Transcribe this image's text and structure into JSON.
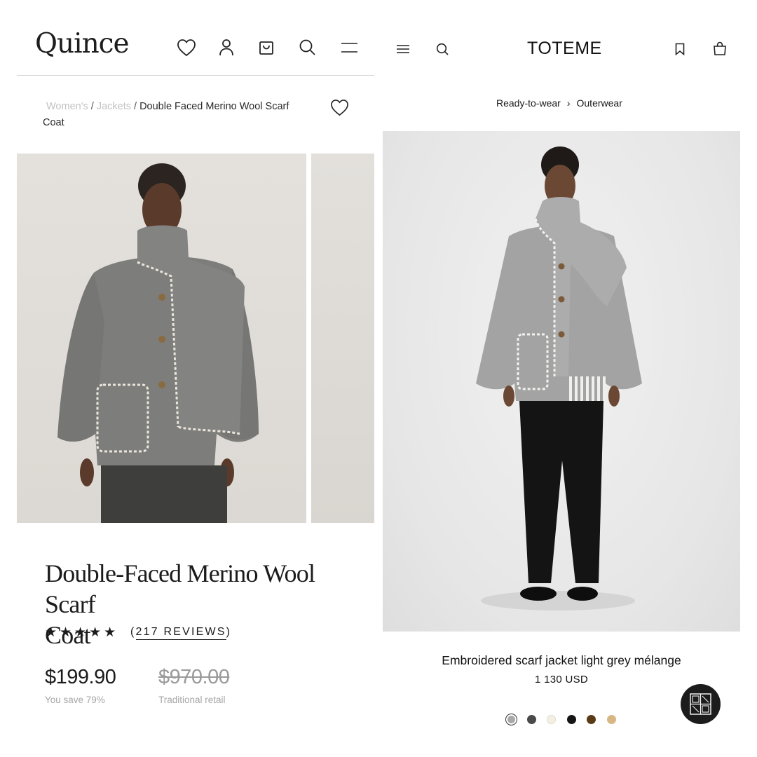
{
  "quince": {
    "logo": "Quince",
    "header_icons": [
      "heart-icon",
      "user-icon",
      "bag-icon",
      "search-icon",
      "menu-icon"
    ],
    "breadcrumb": {
      "level1": "Women's",
      "level2": "Jackets",
      "current_line1": "Double Faced Merino Wool Scarf",
      "current_line2": "Coat",
      "separator": "/"
    },
    "product": {
      "title_line1": "Double-Faced Merino Wool Scarf",
      "title_line2": "Coat",
      "rating_stars": 5,
      "stars": "★★★★★",
      "reviews_open": "(",
      "reviews_label": "217 REVIEWS",
      "reviews_close": ")",
      "price": "$199.90",
      "traditional_price": "$970.00",
      "savings_text": "You save 79%",
      "traditional_label": "Traditional retail"
    }
  },
  "toteme": {
    "logo": "TOTEME",
    "header_icons": [
      "menu-icon",
      "search-icon",
      "bookmark-icon",
      "bag-icon"
    ],
    "breadcrumb": {
      "level1": "Ready-to-wear",
      "chevron": "›",
      "level2": "Outerwear"
    },
    "product": {
      "name": "Embroidered scarf jacket light grey mélange",
      "price": "1 130 USD",
      "color_swatches": [
        "#a9a9a9",
        "#4a4a4a",
        "#f3efe2",
        "#151515",
        "#5b3a17",
        "#d7b884"
      ],
      "selected_swatch_index": 0
    },
    "brand_badge": "TOTEME"
  }
}
